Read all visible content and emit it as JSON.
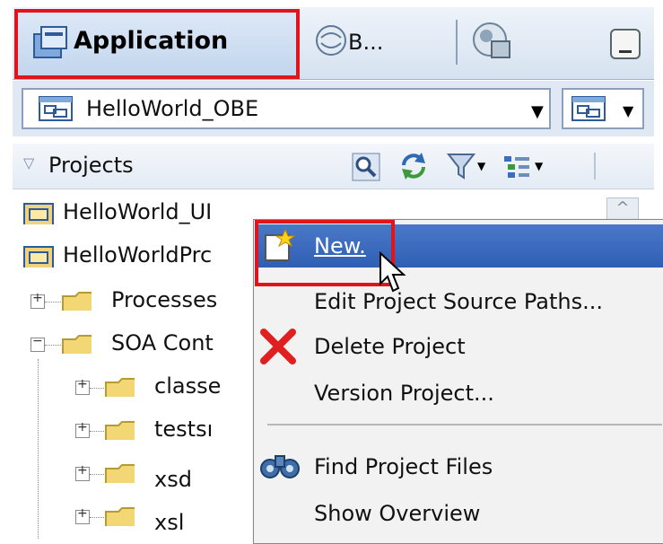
{
  "tabs": {
    "application_label": "Application",
    "second_label": "B..."
  },
  "app_selector": {
    "value": "HelloWorld_OBE"
  },
  "projects_header": {
    "label": "Projects"
  },
  "tree": {
    "items": [
      {
        "label": "HelloWorld_UI"
      },
      {
        "label": "HelloWorldPrc"
      },
      {
        "label": "Processes"
      },
      {
        "label": "SOA Cont"
      },
      {
        "label": "classe"
      },
      {
        "label": "testsı"
      },
      {
        "label": "xsd"
      },
      {
        "label": "xsl"
      }
    ]
  },
  "context_menu": {
    "new": "New.",
    "edit_source_paths": "Edit Project Source Paths...",
    "delete_project": "Delete Project",
    "version_project": "Version Project...",
    "find_project_files": "Find Project Files",
    "show_overview": "Show Overview"
  },
  "colors": {
    "highlight": "#e0141a",
    "selection": "#3a68bc"
  }
}
